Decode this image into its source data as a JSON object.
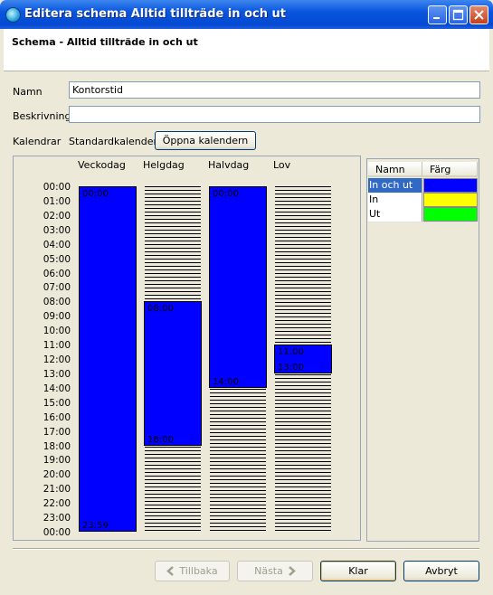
{
  "window": {
    "title": "Editera schema Alltid tillträde in och ut",
    "colors": {
      "titlebar": "#0a56df",
      "block": "#0000ff"
    }
  },
  "header": {
    "heading": "Schema - Alltid tillträde in och ut"
  },
  "form": {
    "name_label": "Namn",
    "name_value": "Kontorstid",
    "description_label": "Beskrivning",
    "description_value": "",
    "calendar_label": "Kalendrar",
    "calendar_value": "Standardkalender",
    "open_calendar_button": "Öppna kalendern"
  },
  "schedule": {
    "columns": [
      "Veckodag",
      "Helgdag",
      "Halvdag",
      "Lov"
    ],
    "hours": [
      "00:00",
      "01:00",
      "02:00",
      "03:00",
      "04:00",
      "05:00",
      "06:00",
      "07:00",
      "08:00",
      "09:00",
      "10:00",
      "11:00",
      "12:00",
      "13:00",
      "14:00",
      "15:00",
      "16:00",
      "17:00",
      "18:00",
      "19:00",
      "20:00",
      "21:00",
      "22:00",
      "23:00",
      "00:00"
    ],
    "blocks": [
      {
        "column": "Veckodag",
        "start": "00:00",
        "end": "23:59"
      },
      {
        "column": "Helgdag",
        "start": "08:00",
        "end": "18:00"
      },
      {
        "column": "Halvdag",
        "start": "00:00",
        "end": "14:00"
      },
      {
        "column": "Lov",
        "start": "11:00",
        "end": "13:00"
      }
    ]
  },
  "legend": {
    "headers": {
      "name": "Namn",
      "color": "Färg"
    },
    "rows": [
      {
        "name": "In och ut",
        "color": "#0000ff",
        "selected": true
      },
      {
        "name": "In",
        "color": "#ffff00",
        "selected": false
      },
      {
        "name": "Ut",
        "color": "#00ff00",
        "selected": false
      }
    ]
  },
  "footer": {
    "back_button": "Tillbaka",
    "next_button": "Nästa",
    "finish_button": "Klar",
    "cancel_button": "Avbryt"
  }
}
